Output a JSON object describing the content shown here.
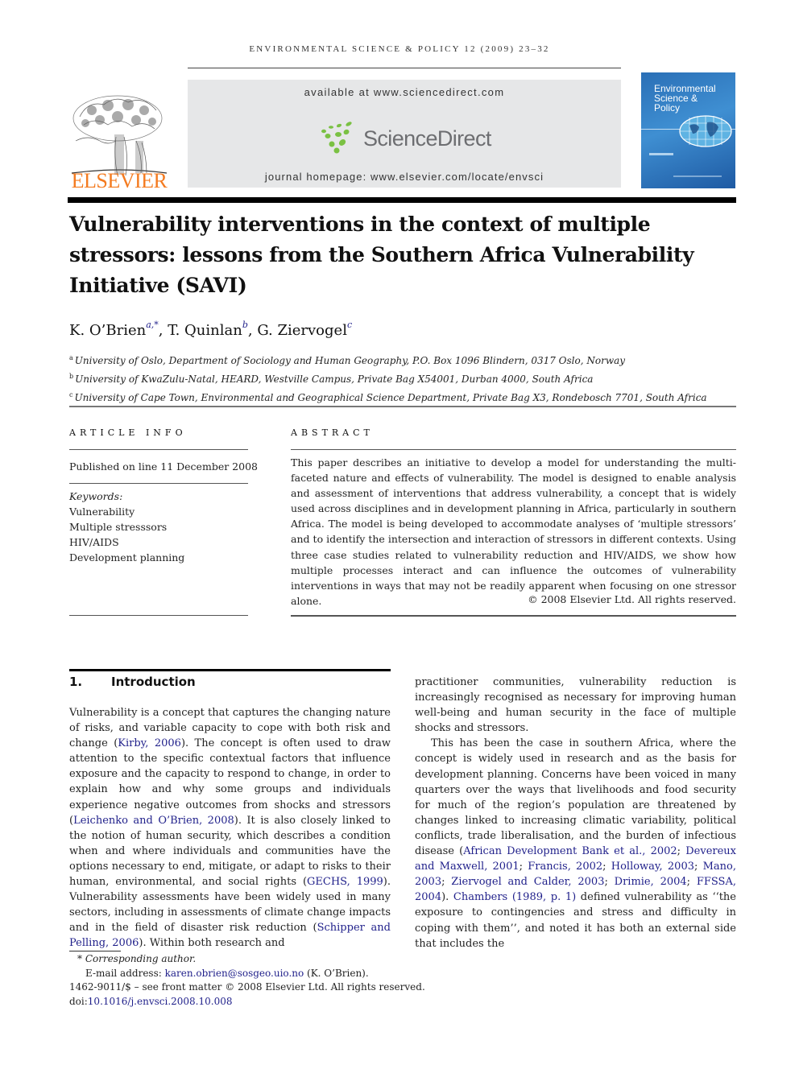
{
  "running_header": "ENVIRONMENTAL SCIENCE & POLICY 12 (2009) 23–32",
  "publisher": {
    "name": "ELSEVIER",
    "logo_icon": "elsevier-tree-icon",
    "color": "#f47b20"
  },
  "banner": {
    "available_at": "available at www.sciencedirect.com",
    "sciencedirect_label": "ScienceDirect",
    "sciencedirect_icon": "sciencedirect-dots-icon",
    "journal_homepage": "journal homepage: www.elsevier.com/locate/envsci",
    "background": "#e6e7e8"
  },
  "journal_cover": {
    "title_line1": "Environmental",
    "title_line2": "Science &",
    "title_line3": "Policy",
    "icon": "globe-icon",
    "color": "#2a6fb6"
  },
  "article": {
    "title": "Vulnerability interventions in the context of multiple stressors: lessons from the Southern Africa Vulnerability Initiative (SAVI)",
    "authors": [
      {
        "name": "K. O’Brien",
        "sup": "a,*"
      },
      {
        "name": "T. Quinlan",
        "sup": "b"
      },
      {
        "name": "G. Ziervogel",
        "sup": "c"
      }
    ],
    "author_separator": ", ",
    "affiliations": [
      {
        "sup": "a",
        "text": "University of Oslo, Department of Sociology and Human Geography, P.O. Box 1096 Blindern, 0317 Oslo, Norway"
      },
      {
        "sup": "b",
        "text": "University of KwaZulu-Natal, HEARD, Westville Campus, Private Bag X54001, Durban 4000, South Africa"
      },
      {
        "sup": "c",
        "text": "University of Cape Town, Environmental and Geographical Science Department, Private Bag X3, Rondebosch 7701, South Africa"
      }
    ]
  },
  "article_info": {
    "heading": "ARTICLE INFO",
    "published": "Published on line 11 December 2008",
    "keywords_label": "Keywords:",
    "keywords": [
      "Vulnerability",
      "Multiple stresssors",
      "HIV/AIDS",
      "Development planning"
    ]
  },
  "abstract": {
    "heading": "ABSTRACT",
    "text": "This paper describes an initiative to develop a model for understanding the multi-faceted nature and effects of vulnerability. The model is designed to enable analysis and assessment of interventions that address vulnerability, a concept that is widely used across disciplines and in development planning in Africa, particularly in southern Africa. The model is being developed to accommodate analyses of ‘multiple stressors’ and to identify the intersection and interaction of stressors in different contexts. Using three case studies related to vulnerability reduction and HIV/AIDS, we show how multiple processes interact and can influence the outcomes of vulnerability interventions in ways that may not be readily apparent when focusing on one stressor alone.",
    "copyright": "© 2008 Elsevier Ltd. All rights reserved."
  },
  "introduction": {
    "number": "1.",
    "heading": "Introduction",
    "left_column": [
      {
        "t": "Vulnerability is a concept that captures the changing nature of risks, and variable capacity to cope with both risk and change ("
      },
      {
        "r": "Kirby, 2006"
      },
      {
        "t": "). The concept is often used to draw attention to the specific contextual factors that influence exposure and the capacity to respond to change, in order to explain how and why some groups and individuals experience negative outcomes from shocks and stressors ("
      },
      {
        "r": "Leichenko and O’Brien, 2008"
      },
      {
        "t": "). It is also closely linked to the notion of human security, which describes a condition when and where individuals and communities have the options necessary to end, mitigate, or adapt to risks to their human, environmental, and social rights ("
      },
      {
        "r": "GECHS, 1999"
      },
      {
        "t": "). Vulnerability assessments have been widely used in many sectors, including in assessments of climate change impacts and in the field of disaster risk reduction ("
      },
      {
        "r": "Schipper and Pelling, 2006"
      },
      {
        "t": "). Within both research and"
      }
    ],
    "right_para1": "practitioner communities, vulnerability reduction is increasingly recognised as necessary for improving human well-being and human security in the face of multiple shocks and stressors.",
    "right_para2": [
      {
        "t": "This has been the case in southern Africa, where the concept is widely used in research and as the basis for development planning. Concerns have been voiced in many quarters over the ways that livelihoods and food security for much of the region’s population are threatened by changes linked to increasing climatic variability, political conflicts, trade liberalisation, and the burden of infectious disease ("
      },
      {
        "r": "African Development Bank et al., 2002"
      },
      {
        "t": "; "
      },
      {
        "r": "Devereux and Maxwell, 2001"
      },
      {
        "t": "; "
      },
      {
        "r": "Francis, 2002"
      },
      {
        "t": "; "
      },
      {
        "r": "Holloway, 2003"
      },
      {
        "t": "; "
      },
      {
        "r": "Mano, 2003"
      },
      {
        "t": "; "
      },
      {
        "r": "Ziervogel and Calder, 2003"
      },
      {
        "t": "; "
      },
      {
        "r": "Drimie, 2004"
      },
      {
        "t": "; "
      },
      {
        "r": "FFSSA, 2004"
      },
      {
        "t": "). "
      },
      {
        "r": "Chambers (1989, p. 1)"
      },
      {
        "t": " defined vulnerability as ‘‘the exposure to contingencies and stress and difficulty in coping with them’’, and noted it has both an external side that includes the"
      }
    ]
  },
  "footnotes": {
    "star": "*",
    "corresponding": "Corresponding author.",
    "email_label": "E-mail address: ",
    "email": "karen.obrien@sosgeo.uio.no",
    "email_suffix": " (K. O’Brien).",
    "front_matter": "1462-9011/$ – see front matter © 2008 Elsevier Ltd. All rights reserved.",
    "doi_label": "doi:",
    "doi": "10.1016/j.envsci.2008.10.008"
  },
  "link_color": "#1f1f8a"
}
